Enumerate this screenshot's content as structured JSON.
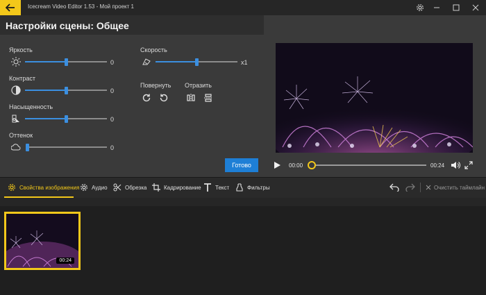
{
  "window": {
    "title": "Icecream Video Editor 1.53  -  Мой проект 1"
  },
  "settings": {
    "title": "Настройки сцены: Общее",
    "brightness": {
      "label": "Яркость",
      "value": "0",
      "level": 0.5
    },
    "contrast": {
      "label": "Контраст",
      "value": "0",
      "level": 0.5
    },
    "saturation": {
      "label": "Насыщенность",
      "value": "0",
      "level": 0.5
    },
    "hue": {
      "label": "Оттенок",
      "value": "0",
      "level": 0.0
    },
    "speed": {
      "label": "Скорость",
      "value": "x1",
      "level": 0.5
    },
    "rotate_label": "Повернуть",
    "mirror_label": "Отразить",
    "done_label": "Готово"
  },
  "player": {
    "current_time": "00:00",
    "duration": "00:24",
    "progress": 0.0
  },
  "toolbar": {
    "tabs": [
      {
        "label": "Свойства изображения",
        "icon": "gear-icon",
        "active": true
      },
      {
        "label": "Аудио",
        "icon": "audio-gear-icon"
      },
      {
        "label": "Обрезка",
        "icon": "scissors-icon"
      },
      {
        "label": "Кадрирование",
        "icon": "crop-icon"
      },
      {
        "label": "Текст",
        "icon": "text-icon"
      },
      {
        "label": "Фильтры",
        "icon": "filters-icon"
      }
    ],
    "clear_label": "Очистить таймлайн"
  },
  "timeline": {
    "clip_duration": "00:24"
  },
  "colors": {
    "accent": "#f3c81a",
    "slider": "#3b8fe0",
    "button": "#1e7fd6"
  }
}
